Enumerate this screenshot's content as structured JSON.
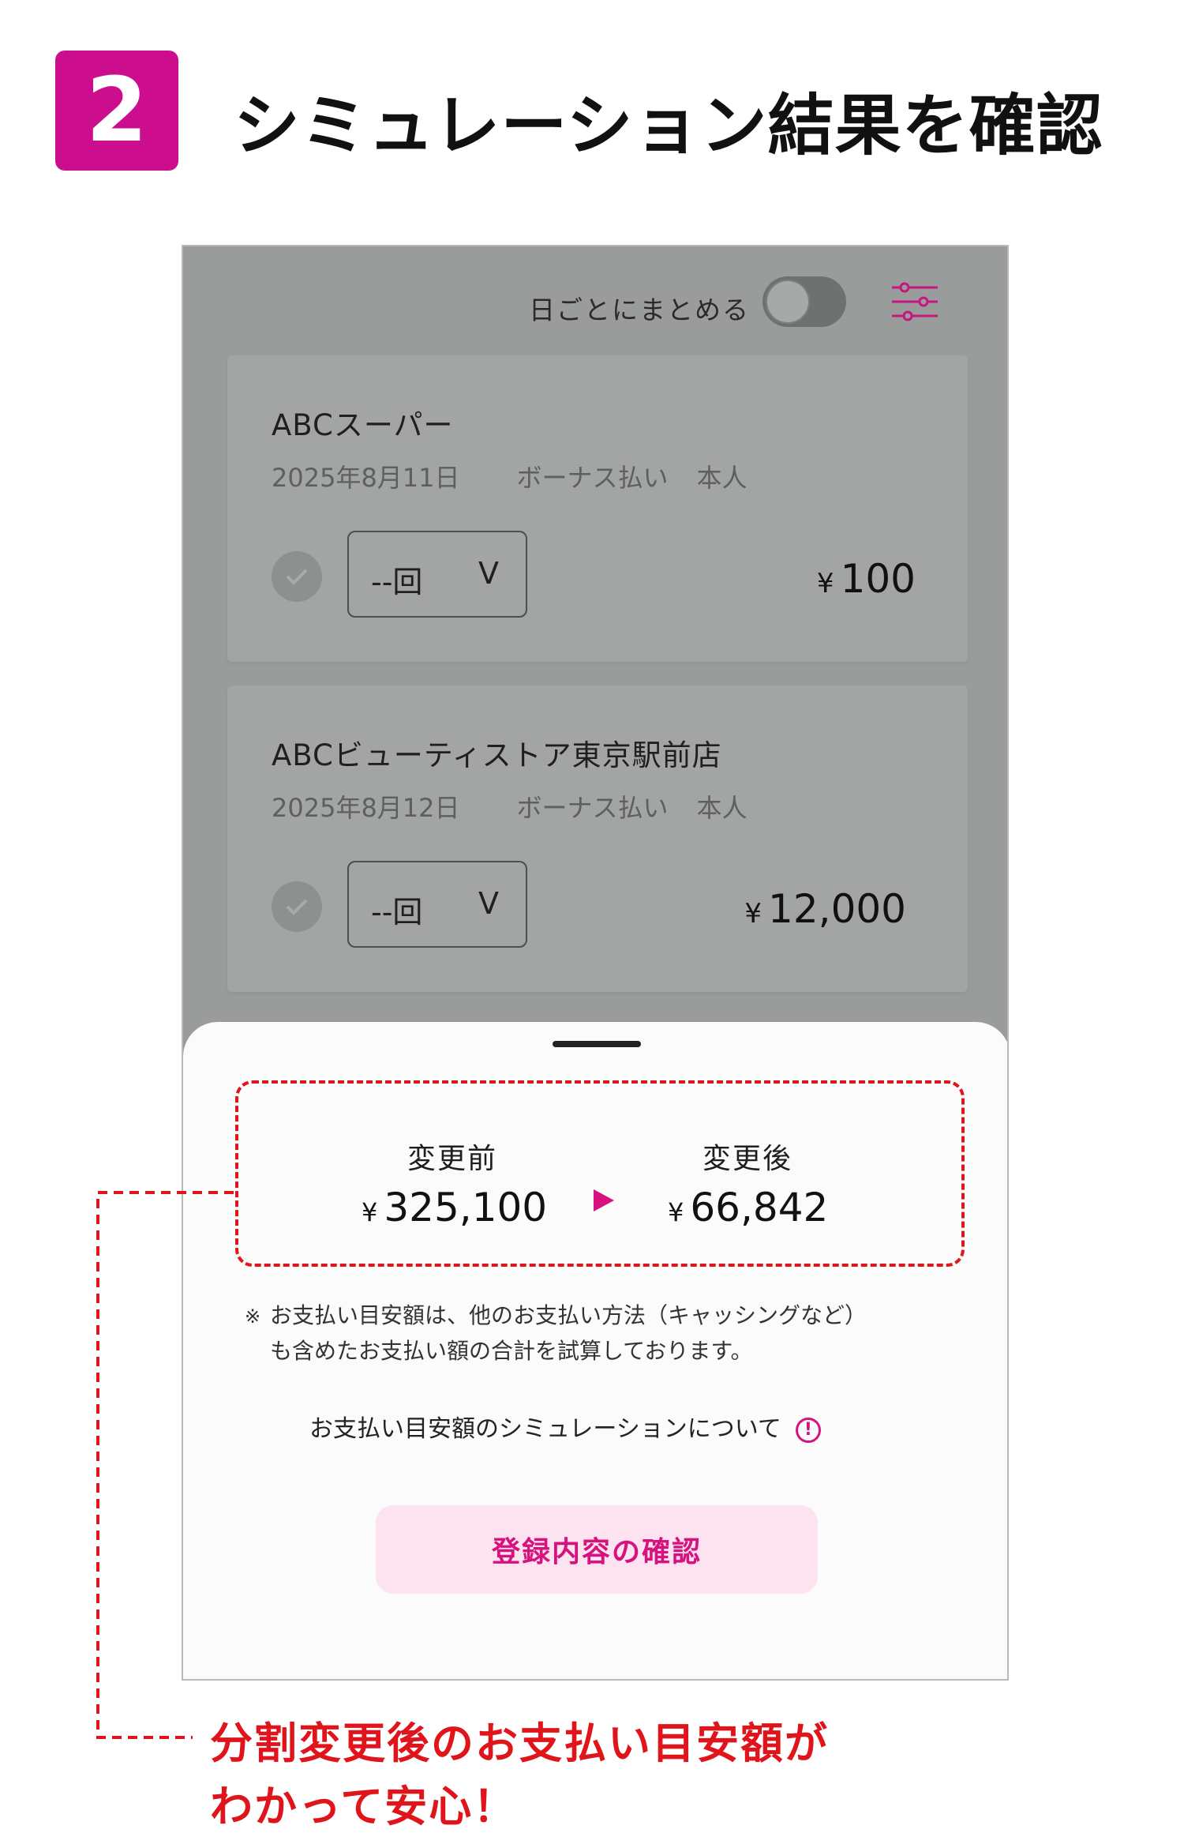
{
  "step": {
    "number": "2",
    "title": "シミュレーション結果を確認"
  },
  "screen": {
    "toggle_label": "日ごとにまとめる",
    "toggle_on": false,
    "filter_icon": "sliders-icon",
    "transactions": [
      {
        "store": "ABCスーパー",
        "date": "2025年8月11日",
        "payment_type": "ボーナス払い",
        "cardholder": "本人",
        "installment_select": "--回",
        "chevron": "V",
        "amount_symbol": "¥",
        "amount": "100"
      },
      {
        "store": "ABCビューティストア東京駅前店",
        "date": "2025年8月12日",
        "payment_type": "ボーナス払い",
        "cardholder": "本人",
        "installment_select": "--回",
        "chevron": "V",
        "amount_symbol": "¥",
        "amount": "12,000"
      }
    ],
    "sheet": {
      "before_label": "変更前",
      "before_symbol": "¥",
      "before_amount": "325,100",
      "after_label": "変更後",
      "after_symbol": "¥",
      "after_amount": "66,842",
      "note_mark": "※",
      "note_line1": "お支払い目安額は、他のお支払い方法（キャッシングなど）",
      "note_line2": "も含めたお支払い額の合計を試算しております。",
      "info_link": "お支払い目安額のシミュレーションについて",
      "info_icon_glyph": "!",
      "confirm_button": "登録内容の確認"
    }
  },
  "callout": {
    "line1": "分割変更後のお支払い目安額が",
    "line2": "わかって安心！"
  },
  "colors": {
    "brand_magenta": "#cc0e8e",
    "accent_pink": "#d6127e",
    "button_bg": "#fce3ef",
    "annotation_red": "#e0141b",
    "overlay_gray": "#9a9c9b"
  }
}
